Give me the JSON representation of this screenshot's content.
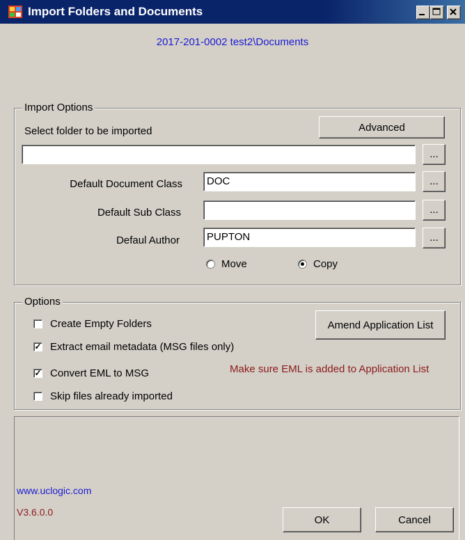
{
  "window": {
    "title": "Import Folders and Documents",
    "path": "2017-201-0002 test2\\Documents"
  },
  "import_options": {
    "legend": "Import Options",
    "select_folder_label": "Select folder to be imported",
    "advanced_label": "Advanced",
    "folder_value": "",
    "browse_label": "...",
    "doc_class_label": "Default Document Class",
    "doc_class_value": "DOC",
    "sub_class_label": "Default Sub Class",
    "sub_class_value": "",
    "author_label": "Defaul Author",
    "author_value": "PUPTON",
    "move_label": "Move",
    "copy_label": "Copy",
    "selected_mode": "Copy"
  },
  "options": {
    "legend": "Options",
    "items": [
      {
        "label": "Create Empty Folders",
        "checked": false
      },
      {
        "label": "Extract email metadata (MSG files only)",
        "checked": true
      },
      {
        "label": "Convert EML to MSG",
        "checked": true
      },
      {
        "label": "Skip files already imported",
        "checked": false
      }
    ],
    "amend_label": "Amend Application List",
    "warning": "Make sure EML is added to Application List",
    "warning_color": "#8b1a1a"
  },
  "footer": {
    "website": "www.uclogic.com",
    "version": "V3.6.0.0",
    "ok_label": "OK",
    "cancel_label": "Cancel"
  },
  "icons": {
    "app": "app-icon",
    "minimize": "minimize-icon",
    "maximize": "maximize-icon",
    "close": "close-icon"
  }
}
